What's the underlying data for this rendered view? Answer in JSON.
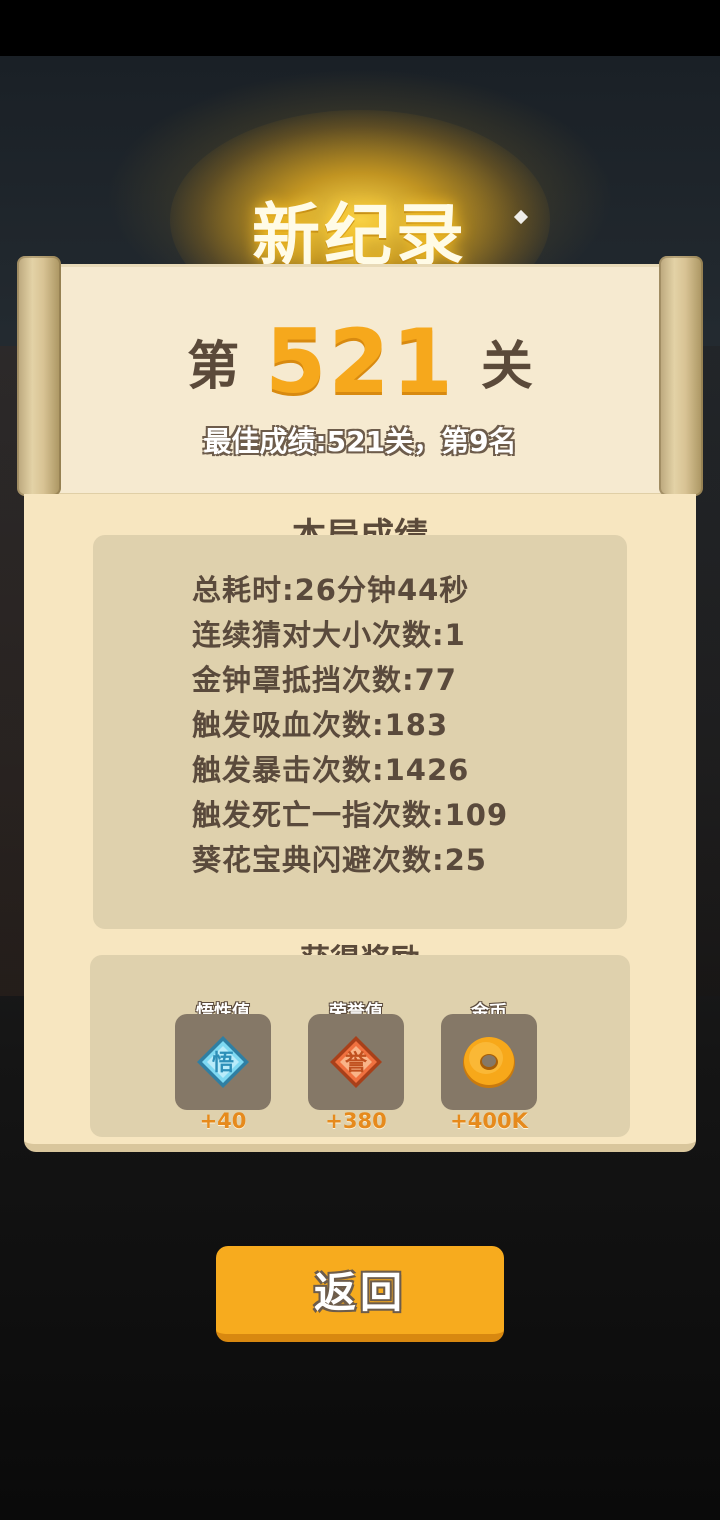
{
  "header": {
    "new_record": "新纪录"
  },
  "level": {
    "prefix": "第",
    "number": "521",
    "suffix": "关",
    "best": "最佳成绩:521关，第9名"
  },
  "stats": {
    "title": "本局成绩",
    "lines": [
      "总耗时:26分钟44秒",
      "连续猜对大小次数:1",
      "金钟罩抵挡次数:77",
      "触发吸血次数:183",
      "触发暴击次数:1426",
      "触发死亡一指次数:109",
      "葵花宝典闪避次数:25"
    ]
  },
  "rewards": {
    "title": "获得奖励",
    "items": [
      {
        "label": "悟性值",
        "amount": "+40",
        "icon": "wuxing-diamond-icon",
        "glyph": "悟",
        "color": "#58c6ea"
      },
      {
        "label": "荣誉值",
        "amount": "+380",
        "icon": "honor-diamond-icon",
        "glyph": "誉",
        "color": "#f0713f"
      },
      {
        "label": "金币",
        "amount": "+400K",
        "icon": "gold-coin-icon",
        "glyph": "",
        "color": "#f7a81a"
      }
    ]
  },
  "buttons": {
    "return_label": "返回"
  },
  "colors": {
    "accent": "#f6a81c",
    "parchment": "#f7e6c0",
    "text_dark": "#5b4a3a",
    "button": "#f7ab1e"
  }
}
